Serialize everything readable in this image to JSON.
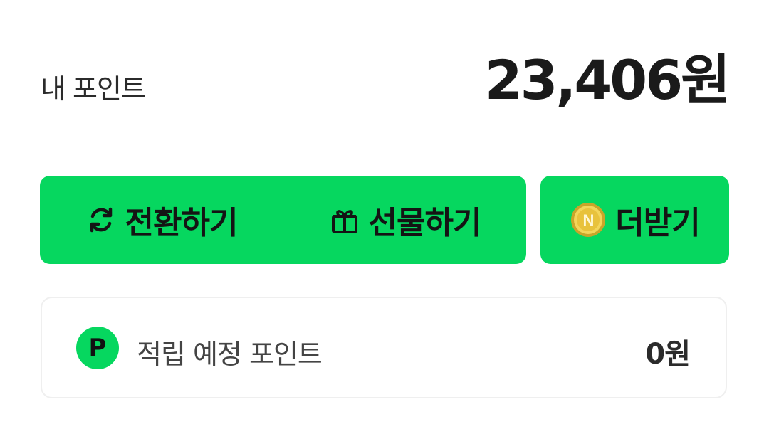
{
  "points": {
    "label": "내 포인트",
    "value": "23,406원"
  },
  "actions": {
    "convert_label": "전환하기",
    "convert_icon": "refresh-icon",
    "gift_label": "선물하기",
    "gift_icon": "gift-icon",
    "more_label": "더받기",
    "more_icon": "coin-icon"
  },
  "pending": {
    "badge": "P",
    "label": "적립 예정 포인트",
    "value": "0원"
  },
  "colors": {
    "accent": "#06d75f",
    "text": "#1a1a1a",
    "card_border": "#efefef"
  }
}
